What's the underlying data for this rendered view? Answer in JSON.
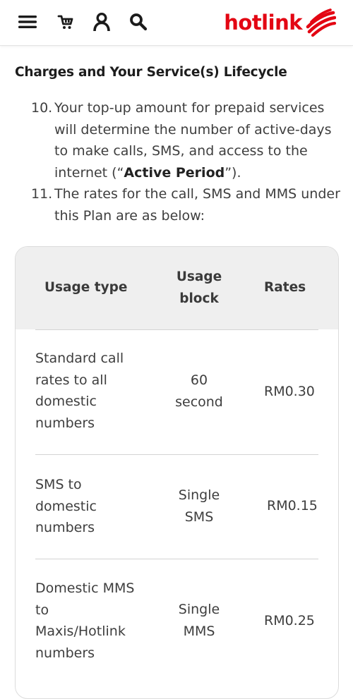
{
  "header": {
    "brand": "hotlink",
    "brand_color": "#e30613",
    "icons": [
      "menu-icon",
      "cart-icon",
      "account-icon",
      "search-icon",
      "hotlink-swirl-logo"
    ]
  },
  "section": {
    "title": "Charges and Your Service(s) Lifecycle"
  },
  "clauses": [
    {
      "number": "10.",
      "text_before": "Your top-up amount for prepaid services will determine the number of active-days to make calls, SMS, and access to the internet (“",
      "bold": "Active Period",
      "text_after": "”)."
    },
    {
      "number": "11.",
      "text": "The rates for the call, SMS and MMS under this Plan are as below:"
    }
  ],
  "rates_table": {
    "headers": {
      "usage_type": "Usage type",
      "usage_block": "Usage block",
      "rates": "Rates"
    },
    "rows": [
      {
        "usage_type": "Standard call rates to all domestic numbers",
        "usage_block": "60 second",
        "rate": "RM0.30"
      },
      {
        "usage_type": "SMS to domestic numbers",
        "usage_block": "Single SMS",
        "rate": "RM0.15"
      },
      {
        "usage_type": "Domestic MMS to Maxis/Hotlink numbers",
        "usage_block": "Single MMS",
        "rate": "RM0.25"
      }
    ]
  }
}
